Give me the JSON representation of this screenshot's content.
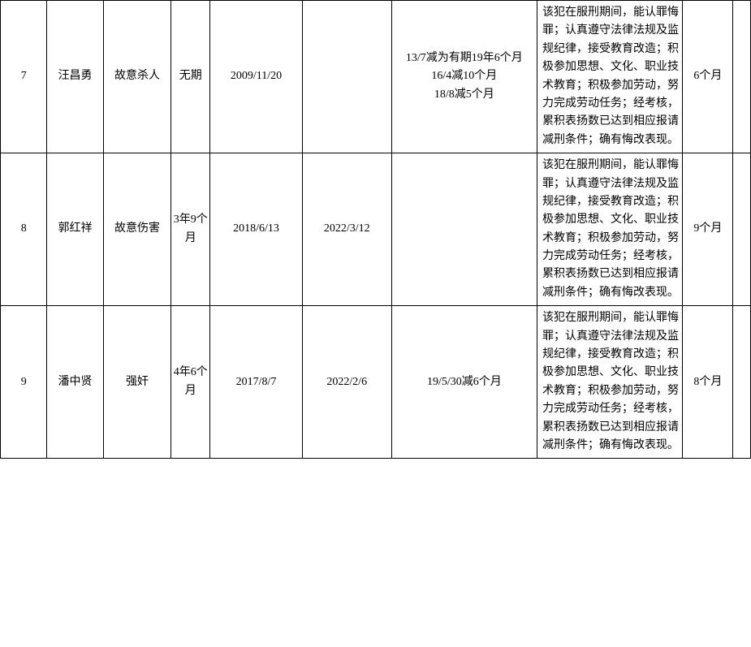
{
  "rows": [
    {
      "index": "7",
      "name": "汪昌勇",
      "crime": "故意杀人",
      "term": "无期",
      "start_date": "2009/11/20",
      "end_date": "",
      "history": "13/7减为有期19年6个月\n16/4减10个月\n18/8减5个月",
      "description": "该犯在服刑期间，能认罪悔罪；认真遵守法律法规及监规纪律，接受教育改造；积极参加思想、文化、职业技术教育；积极参加劳动，努力完成劳动任务；经考核，累积表扬数已达到相应报请减刑条件；确有悔改表现。",
      "reduction": "6个月",
      "extra": ""
    },
    {
      "index": "8",
      "name": "郭红祥",
      "crime": "故意伤害",
      "term": "3年9个月",
      "start_date": "2018/6/13",
      "end_date": "2022/3/12",
      "history": "",
      "description": "该犯在服刑期间，能认罪悔罪；认真遵守法律法规及监规纪律，接受教育改造；积极参加思想、文化、职业技术教育；积极参加劳动，努力完成劳动任务；经考核，累积表扬数已达到相应报请减刑条件；确有悔改表现。",
      "reduction": "9个月",
      "extra": ""
    },
    {
      "index": "9",
      "name": "潘中贤",
      "crime": "强奸",
      "term": "4年6个月",
      "start_date": "2017/8/7",
      "end_date": "2022/2/6",
      "history": "19/5/30减6个月",
      "description": "该犯在服刑期间，能认罪悔罪；认真遵守法律法规及监规纪律，接受教育改造；积极参加思想、文化、职业技术教育；积极参加劳动，努力完成劳动任务；经考核，累积表扬数已达到相应报请减刑条件；确有悔改表现。",
      "reduction": "8个月",
      "extra": ""
    }
  ]
}
